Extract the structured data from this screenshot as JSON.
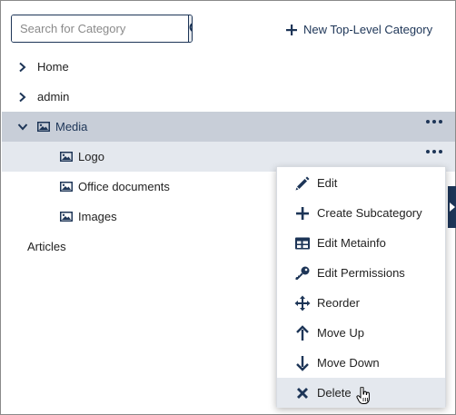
{
  "search": {
    "placeholder": "Search for Category"
  },
  "toolbar": {
    "new_category_label": "New Top-Level Category"
  },
  "tree": {
    "home": "Home",
    "admin": "admin",
    "media": "Media",
    "logo": "Logo",
    "office_documents": "Office documents",
    "images": "Images",
    "articles": "Articles"
  },
  "context_menu": {
    "items": [
      {
        "label": "Edit",
        "icon": "pencil-icon"
      },
      {
        "label": "Create Subcategory",
        "icon": "plus-icon"
      },
      {
        "label": "Edit Metainfo",
        "icon": "table-icon"
      },
      {
        "label": "Edit Permissions",
        "icon": "key-icon"
      },
      {
        "label": "Reorder",
        "icon": "move-icon"
      },
      {
        "label": "Move Up",
        "icon": "arrow-up-icon"
      },
      {
        "label": "Move Down",
        "icon": "arrow-down-icon"
      },
      {
        "label": "Delete",
        "icon": "x-icon"
      }
    ],
    "hovered": "Delete"
  },
  "colors": {
    "accent": "#1d3557",
    "selected_row": "#c8ced8",
    "hover_row": "#e4e8ee"
  }
}
